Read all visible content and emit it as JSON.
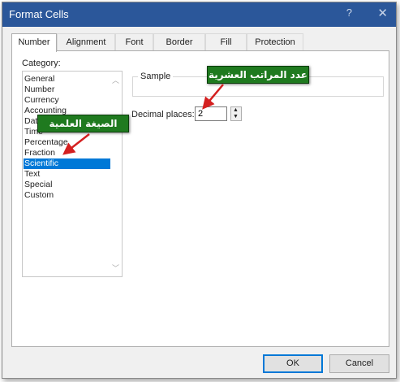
{
  "window": {
    "title": "Format Cells",
    "help": "?",
    "close": "✕"
  },
  "tabs": [
    {
      "label": "Number",
      "active": true
    },
    {
      "label": "Alignment"
    },
    {
      "label": "Font"
    },
    {
      "label": "Border"
    },
    {
      "label": "Fill"
    },
    {
      "label": "Protection"
    }
  ],
  "category": {
    "label": "Category:",
    "items": [
      "General",
      "Number",
      "Currency",
      "Accounting",
      "Date",
      "Time",
      "Percentage",
      "Fraction",
      "Scientific",
      "Text",
      "Special",
      "Custom"
    ],
    "selected": "Scientific"
  },
  "sample": {
    "label": "Sample"
  },
  "decimal_places": {
    "label": "Decimal places:",
    "value": "2"
  },
  "buttons": {
    "ok": "OK",
    "cancel": "Cancel"
  },
  "annotations": {
    "decimal_callout": "عدد المراتب العشرية",
    "scientific_callout": "الصيغة العلمية",
    "color": "#1f7a1f",
    "arrow_color": "#d42020"
  },
  "colors": {
    "titlebar": "#2b579a",
    "selection": "#0078d7"
  }
}
